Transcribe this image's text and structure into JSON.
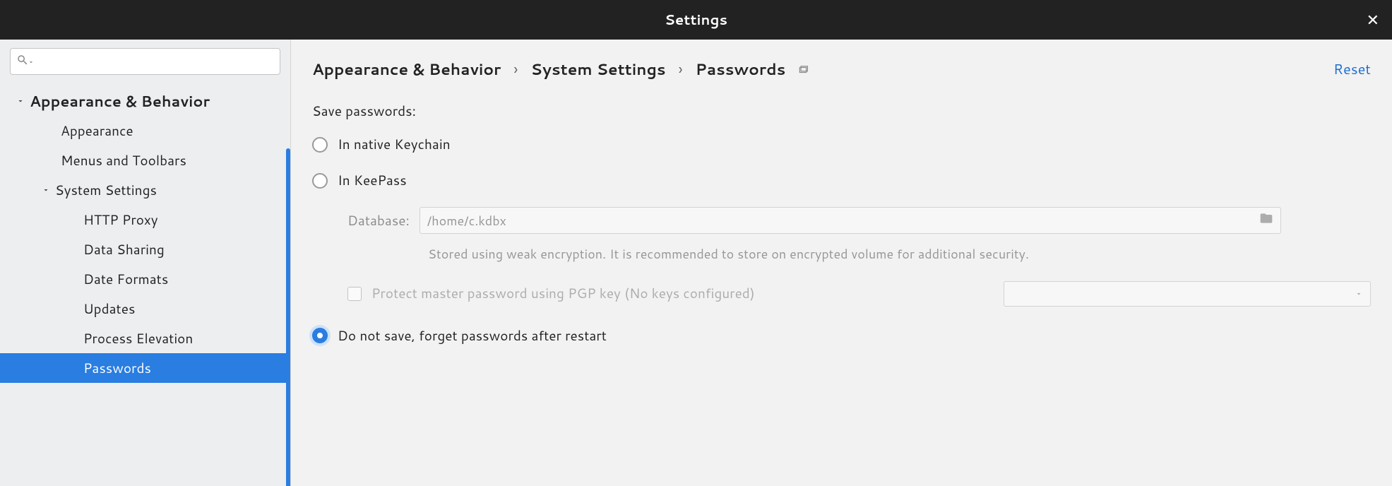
{
  "titlebar": {
    "title": "Settings"
  },
  "sidebar": {
    "search_placeholder": "",
    "items": [
      {
        "label": "Appearance & Behavior",
        "level": 0,
        "has_expand": true
      },
      {
        "label": "Appearance",
        "level": 1
      },
      {
        "label": "Menus and Toolbars",
        "level": 1
      },
      {
        "label": "System Settings",
        "level": 1,
        "has_expand": true
      },
      {
        "label": "HTTP Proxy",
        "level": 2
      },
      {
        "label": "Data Sharing",
        "level": 2
      },
      {
        "label": "Date Formats",
        "level": 2
      },
      {
        "label": "Updates",
        "level": 2
      },
      {
        "label": "Process Elevation",
        "level": 2
      },
      {
        "label": "Passwords",
        "level": 2,
        "selected": true
      }
    ]
  },
  "breadcrumb": {
    "parts": [
      "Appearance & Behavior",
      "System Settings",
      "Passwords"
    ],
    "reset": "Reset"
  },
  "form": {
    "heading_save": "Save passwords:",
    "radio_native": "In native Keychain",
    "radio_keepass": "In KeePass",
    "db_label": "Database:",
    "db_value": "/home/c.kdbx",
    "db_note": "Stored using weak encryption. It is recommended to store on encrypted volume for additional security.",
    "check_pgp": "Protect master password using PGP key (No keys configured)",
    "radio_donotsave": "Do not save, forget passwords after restart"
  }
}
